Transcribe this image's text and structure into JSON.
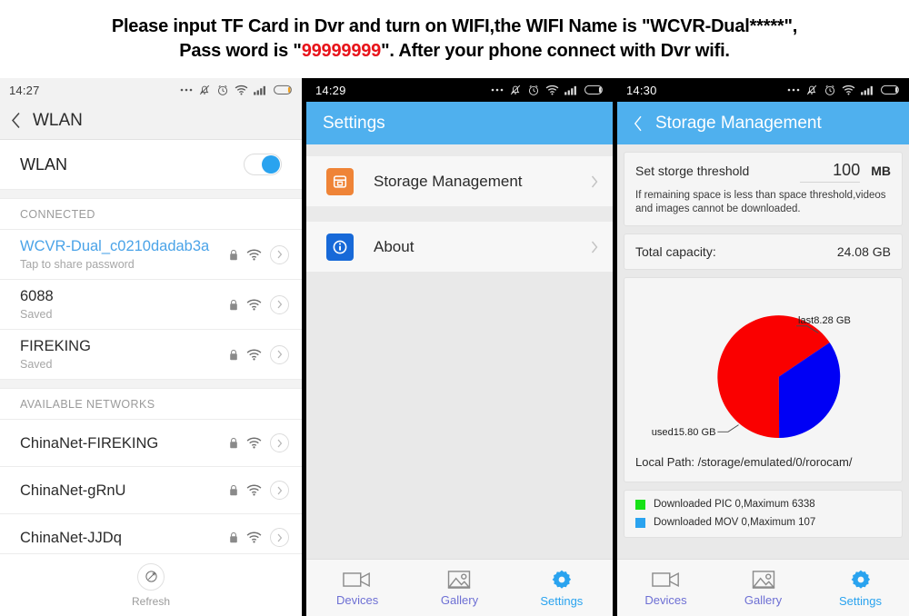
{
  "banner": {
    "line1_a": "Please input TF Card in Dvr and turn on WIFI,the WIFI Name is \"WCVR-Dual*****\",",
    "line2_a": "Pass word is \"",
    "line2_pwd": "99999999",
    "line2_b": "\". After your phone connect with Dvr wifi."
  },
  "phone1": {
    "statusbar": {
      "time": "14:27"
    },
    "appbar": {
      "back_icon": "chevron-left-icon",
      "title": "WLAN"
    },
    "wlan_toggle": {
      "label": "WLAN",
      "state": "on"
    },
    "connected_header": "CONNECTED",
    "available_header": "AVAILABLE NETWORKS",
    "connected_networks": [
      {
        "name": "WCVR-Dual_c0210dadab3a",
        "sub": "Tap to share password",
        "highlight": true
      },
      {
        "name": "6088",
        "sub": "Saved",
        "highlight": false
      },
      {
        "name": "FIREKING",
        "sub": "Saved",
        "highlight": false
      }
    ],
    "available_networks": [
      {
        "name": "ChinaNet-FIREKING",
        "sub": ""
      },
      {
        "name": "ChinaNet-gRnU",
        "sub": ""
      },
      {
        "name": "ChinaNet-JJDq",
        "sub": ""
      }
    ],
    "refresh": {
      "label": "Refresh",
      "icon": "refresh-icon"
    }
  },
  "phone2": {
    "statusbar": {
      "time": "14:29"
    },
    "appbar": {
      "title": "Settings"
    },
    "rows": [
      {
        "label": "Storage Management",
        "icon": "storage-icon",
        "icon_color": "#ef8437"
      },
      {
        "label": "About",
        "icon": "info-icon",
        "icon_color": "#1769d8"
      }
    ],
    "tabs": [
      {
        "label": "Devices",
        "icon": "videocamera-icon",
        "active": false
      },
      {
        "label": "Gallery",
        "icon": "image-icon",
        "active": false
      },
      {
        "label": "Settings",
        "icon": "gear-icon",
        "active": true
      }
    ]
  },
  "phone3": {
    "statusbar": {
      "time": "14:30"
    },
    "appbar": {
      "back_icon": "chevron-left-icon",
      "title": "Storage Management"
    },
    "threshold": {
      "label": "Set storge threshold",
      "value": "100",
      "unit": "MB",
      "note": "If remaining space is less than space threshold,videos and images cannot be downloaded."
    },
    "capacity": {
      "label": "Total capacity:",
      "value": "24.08 GB"
    },
    "local_path": {
      "label": "Local Path:",
      "value": "/storage/emulated/0/rorocam/"
    },
    "legend": [
      {
        "color": "#17e217",
        "text": "Downloaded PIC 0,Maximum 6338"
      },
      {
        "color": "#2aa3ef",
        "text": "Downloaded MOV 0,Maximum 107"
      }
    ],
    "tabs": [
      {
        "label": "Devices",
        "icon": "videocamera-icon",
        "active": false
      },
      {
        "label": "Gallery",
        "icon": "image-icon",
        "active": false
      },
      {
        "label": "Settings",
        "icon": "gear-icon",
        "active": true
      }
    ]
  },
  "chart_data": {
    "type": "pie",
    "title": "",
    "labels": [
      "last8.28 GB",
      "used15.80 GB"
    ],
    "values": [
      8.28,
      15.8
    ],
    "unit": "GB",
    "total": 24.08,
    "colors": [
      "#0000f5",
      "#fa0000"
    ],
    "start_angle_deg": -34,
    "direction": "clockwise",
    "legend": "none",
    "annotations": [
      "last8.28 GB",
      "used15.80 GB"
    ]
  }
}
